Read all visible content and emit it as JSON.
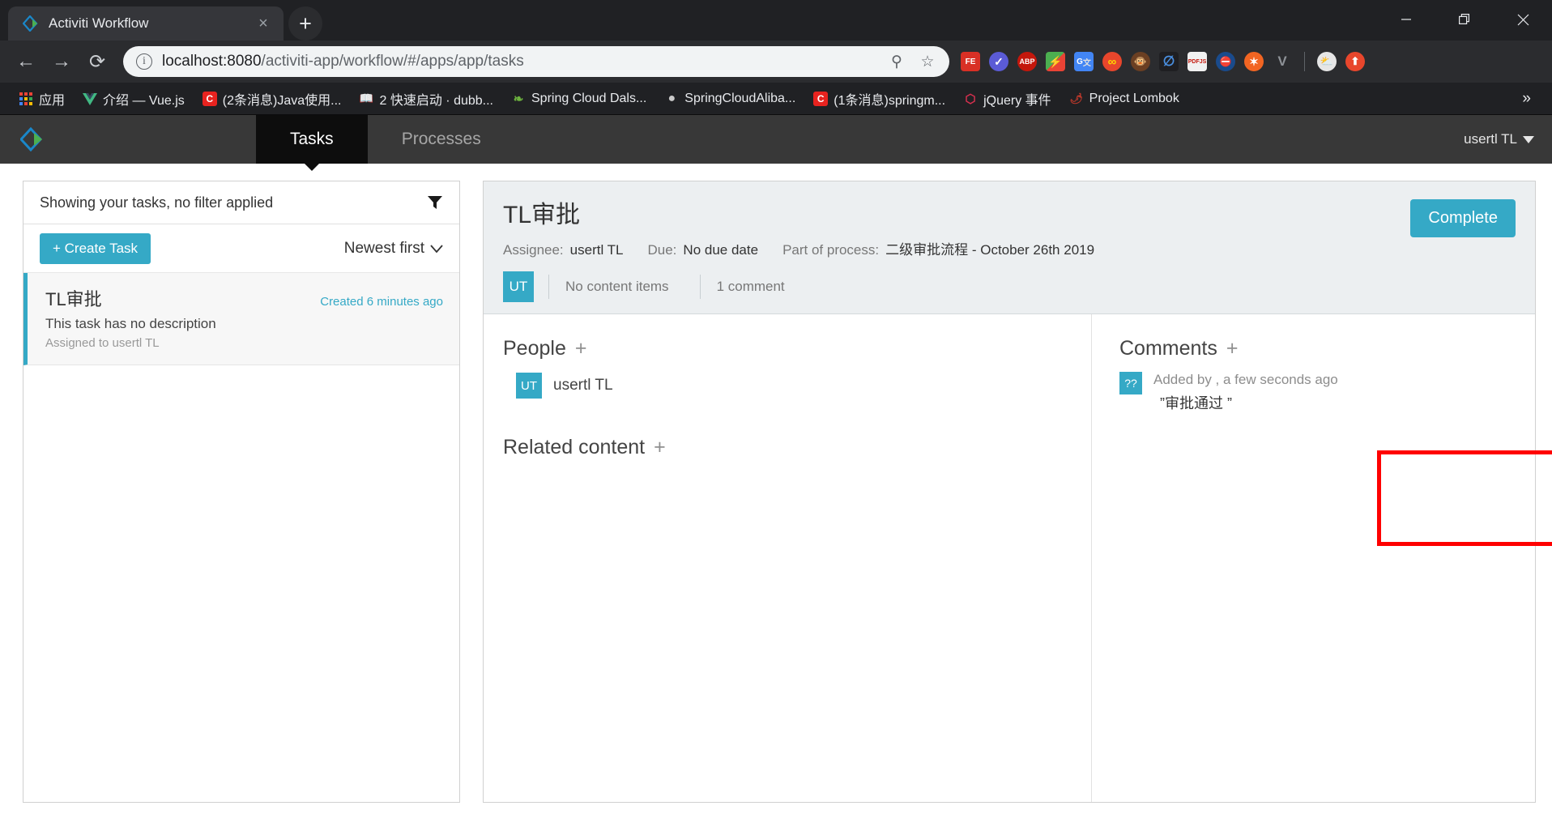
{
  "browser": {
    "tab": {
      "title": "Activiti Workflow",
      "favicon": "activiti-diamond-icon",
      "close_label": "×"
    },
    "new_tab_label": "+",
    "window_controls": {
      "minimize": "—",
      "maximize": "❐",
      "close": "✕"
    },
    "nav": {
      "back": "←",
      "forward": "→",
      "reload": "⟳"
    },
    "omnibox": {
      "info_icon": "ⓘ",
      "url_host": "localhost:8080",
      "url_path": "/activiti-app/workflow/#/apps/app/tasks",
      "url_full": "localhost:8080/activiti-app/workflow/#/apps/app/tasks",
      "zoom_icon": "⚲",
      "bookmark_star_icon": "☆"
    },
    "extensions": [
      {
        "name": "fe-helper-icon",
        "label": "FE",
        "bg": "#d93025",
        "color": "#ffffff"
      },
      {
        "name": "check-circle-icon",
        "label": "✓",
        "bg": "#5b5bd6",
        "color": "#ffffff"
      },
      {
        "name": "adblock-plus-icon",
        "label": "ABP",
        "bg": "#c4170c",
        "color": "#ffffff"
      },
      {
        "name": "lightning-colors-icon",
        "label": "⚡",
        "bg": "#34a853",
        "color": "#ffffff"
      },
      {
        "name": "google-translate-icon",
        "label": "G",
        "bg": "#4285f4",
        "color": "#ffffff"
      },
      {
        "name": "infinity-icon",
        "label": "∞",
        "bg": "#e8462c",
        "color": "#ffd400"
      },
      {
        "name": "monkey-icon",
        "label": "◉",
        "bg": "#3b2a1a",
        "color": "#e8b05a"
      },
      {
        "name": "leaf-icon",
        "label": "⌀",
        "bg": "#1a1a1a",
        "color": "#4a90e2"
      },
      {
        "name": "pdfjs-icon",
        "label": "PDF",
        "bg": "#f1f1f1",
        "color": "#c4170c"
      },
      {
        "name": "blocker-icon",
        "label": "⛔",
        "bg": "#1a4b8c",
        "color": "#ffffff"
      },
      {
        "name": "orange-gear-icon",
        "label": "✶",
        "bg": "#f26522",
        "color": "#ffffff"
      },
      {
        "name": "vue-devtools-icon",
        "label": "V",
        "bg": "#2b2c2f",
        "color": "#8e9297"
      },
      {
        "name": "weather-icon",
        "label": "⛅",
        "bg": "#e8e8e8",
        "color": "#f5a623"
      },
      {
        "name": "upload-arrow-icon",
        "label": "↑",
        "bg": "#e8462c",
        "color": "#ffffff"
      }
    ],
    "bookmarks": [
      {
        "label": "应用",
        "icon_name": "apps-grid-icon",
        "icon_text": "⋮⋮",
        "icon_bg": "transparent",
        "icon_color": "#e8462c"
      },
      {
        "label": "介绍 — Vue.js",
        "icon_name": "vuejs-icon",
        "icon_text": "V",
        "icon_bg": "transparent",
        "icon_color": "#41b883"
      },
      {
        "label": "(2条消息)Java使用...",
        "icon_name": "csdn-icon",
        "icon_text": "C",
        "icon_bg": "#e8231f",
        "icon_color": "#ffffff"
      },
      {
        "label": "2 快速启动 · dubb...",
        "icon_name": "book-icon",
        "icon_text": "📖",
        "icon_bg": "transparent",
        "icon_color": "#e8e8e8"
      },
      {
        "label": "Spring Cloud Dals...",
        "icon_name": "spring-icon",
        "icon_text": "✿",
        "icon_bg": "transparent",
        "icon_color": "#6db33f"
      },
      {
        "label": "SpringCloudAliba...",
        "icon_name": "github-icon",
        "icon_text": "●",
        "icon_bg": "transparent",
        "icon_color": "#c9c9c9"
      },
      {
        "label": "(1条消息)springm...",
        "icon_name": "csdn-icon",
        "icon_text": "C",
        "icon_bg": "#e8231f",
        "icon_color": "#ffffff"
      },
      {
        "label": "jQuery 事件",
        "icon_name": "jquery-icon",
        "icon_text": "⬡",
        "icon_bg": "transparent",
        "icon_color": "#d9304f"
      },
      {
        "label": "Project Lombok",
        "icon_name": "lombok-chili-icon",
        "icon_text": "🌶",
        "icon_bg": "transparent",
        "icon_color": "#c0392b"
      }
    ],
    "bookmarks_overflow": "»"
  },
  "app": {
    "logo_name": "activiti-logo-icon",
    "tabs": [
      {
        "label": "Tasks",
        "active": true
      },
      {
        "label": "Processes",
        "active": false
      }
    ],
    "user_menu": {
      "label": "usertl TL",
      "caret": "⌄"
    }
  },
  "tasklist": {
    "filter_text": "Showing your tasks, no filter applied",
    "filter_icon": "funnel-icon",
    "create_button": "+ Create Task",
    "sort_label": "Newest first",
    "sort_caret": "⌄",
    "items": [
      {
        "name": "TL审批",
        "created": "Created 6 minutes ago",
        "description": "This task has no description",
        "assigned": "Assigned to usertl TL",
        "selected": true
      }
    ]
  },
  "detail": {
    "title": "TL审批",
    "assignee_label": "Assignee:",
    "assignee_value": "usertl TL",
    "due_label": "Due:",
    "due_value": "No due date",
    "process_label": "Part of process:",
    "process_value": "二级审批流程 - October 26th 2019",
    "avatar_initials": "UT",
    "content_items": "No content items",
    "comment_count": "1 comment",
    "complete_button": "Complete",
    "people": {
      "title": "People",
      "add": "+",
      "members": [
        {
          "initials": "UT",
          "name": "usertl TL"
        }
      ]
    },
    "related_content": {
      "title": "Related content",
      "add": "+"
    },
    "comments": {
      "title": "Comments",
      "add": "+",
      "items": [
        {
          "avatar_initials": "??",
          "meta": "Added by , a few seconds ago",
          "text": "”审批通过 ”"
        }
      ]
    }
  },
  "annotation": {
    "highlight_color": "#ff0000",
    "highlight_target": "comments-section"
  }
}
